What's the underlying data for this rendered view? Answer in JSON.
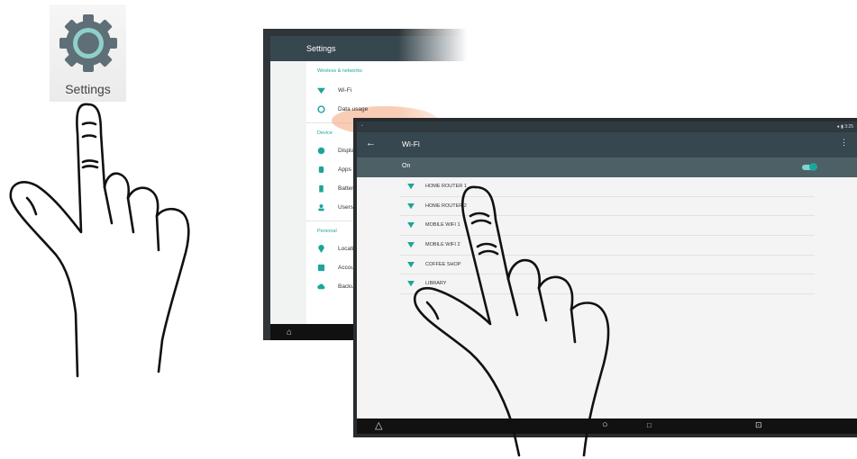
{
  "app_icon": {
    "label": "Settings",
    "icon": "gear-icon"
  },
  "back_screen": {
    "title": "Settings",
    "sections": [
      {
        "title": "Wireless & networks",
        "items": [
          {
            "label": "Wi-Fi",
            "icon": "wifi-icon"
          },
          {
            "label": "Data usage",
            "icon": "data-usage-icon"
          }
        ]
      },
      {
        "title": "Device",
        "items": [
          {
            "label": "Displa",
            "icon": "display-icon"
          },
          {
            "label": "Apps",
            "icon": "apps-icon"
          },
          {
            "label": "Batter",
            "icon": "battery-icon"
          },
          {
            "label": "Users",
            "icon": "users-icon"
          }
        ]
      },
      {
        "title": "Personal",
        "items": [
          {
            "label": "Locati",
            "icon": "location-icon"
          },
          {
            "label": "Accou",
            "icon": "accounts-icon"
          },
          {
            "label": "Backu",
            "icon": "backup-icon"
          }
        ]
      }
    ]
  },
  "front_screen": {
    "status_time": "3:25",
    "title": "Wi-Fi",
    "toggle_label": "On",
    "toggle_on": true,
    "networks": [
      {
        "name": "HOME ROUTER 1"
      },
      {
        "name": "HOME ROUTER 2"
      },
      {
        "name": "MOBILE WIFI 1"
      },
      {
        "name": "MOBILE WIFI 2"
      },
      {
        "name": "COFFEE SHOP"
      },
      {
        "name": "LIBRARY"
      }
    ]
  },
  "colors": {
    "accent": "#1da59a",
    "toolbar": "#37474f",
    "highlight": "#f4a478"
  }
}
